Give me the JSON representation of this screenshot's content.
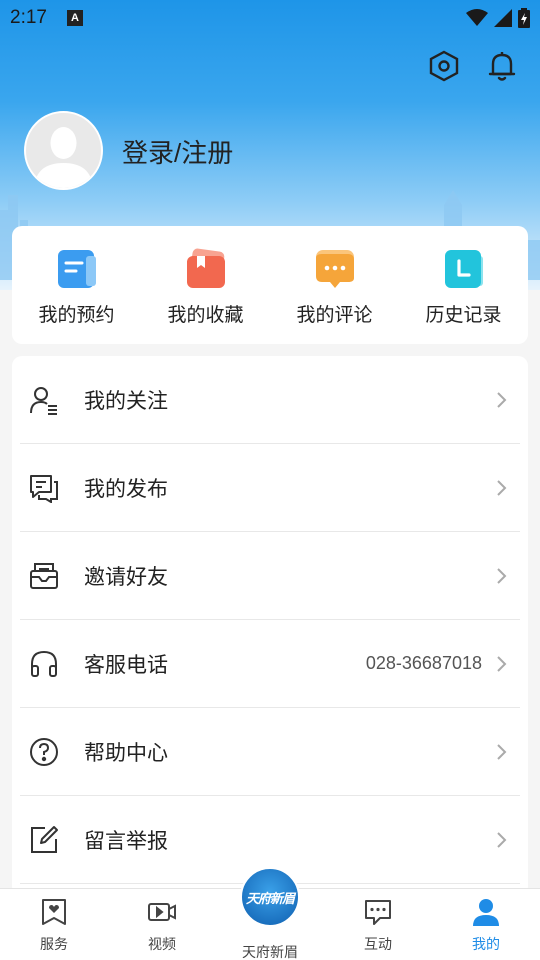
{
  "status_bar": {
    "time": "2:17",
    "notification_badge": "A"
  },
  "header": {
    "login_text": "登录/注册"
  },
  "quick_actions": [
    {
      "label": "我的预约",
      "icon": "appointment-icon",
      "color": "#3b9cf0"
    },
    {
      "label": "我的收藏",
      "icon": "favorites-icon",
      "color": "#f2684f"
    },
    {
      "label": "我的评论",
      "icon": "comment-icon",
      "color": "#f5a53a"
    },
    {
      "label": "历史记录",
      "icon": "history-icon",
      "color": "#22c4dc"
    }
  ],
  "menu": [
    {
      "label": "我的关注",
      "icon": "follow-icon",
      "value": ""
    },
    {
      "label": "我的发布",
      "icon": "publish-icon",
      "value": ""
    },
    {
      "label": "邀请好友",
      "icon": "invite-icon",
      "value": ""
    },
    {
      "label": "客服电话",
      "icon": "headset-icon",
      "value": "028-36687018"
    },
    {
      "label": "帮助中心",
      "icon": "help-icon",
      "value": ""
    },
    {
      "label": "留言举报",
      "icon": "report-icon",
      "value": ""
    }
  ],
  "tabbar": {
    "tabs": [
      {
        "label": "服务",
        "icon": "service-icon"
      },
      {
        "label": "视频",
        "icon": "video-icon"
      },
      {
        "label": "天府新眉",
        "icon": "tianfu-xinmei-logo"
      },
      {
        "label": "互动",
        "icon": "chat-icon"
      },
      {
        "label": "我的",
        "icon": "person-icon"
      }
    ],
    "active": "我的",
    "logo_text": "天府新眉"
  },
  "colors": {
    "accent": "#1f8ce6",
    "header_top": "#1e95e8"
  }
}
